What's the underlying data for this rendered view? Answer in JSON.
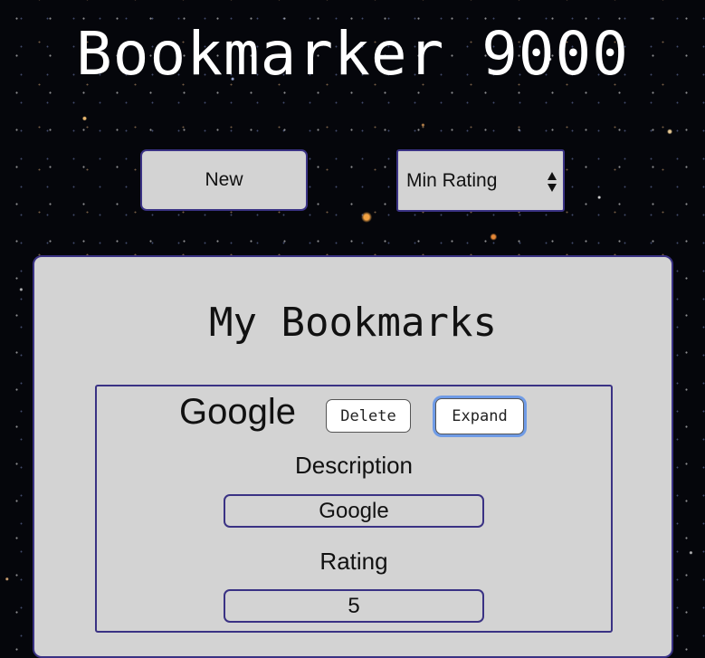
{
  "app": {
    "title": "Bookmarker 9000"
  },
  "toolbar": {
    "new_label": "New",
    "filter": {
      "selected": "Min Rating"
    }
  },
  "panel": {
    "title": "My Bookmarks"
  },
  "bookmarks": [
    {
      "title": "Google",
      "delete_label": "Delete",
      "expand_label": "Expand",
      "description_label": "Description",
      "description": "Google",
      "rating_label": "Rating",
      "rating": "5"
    }
  ],
  "colors": {
    "border": "#3a3284",
    "panel_bg": "#d3d3d3",
    "focus_ring": "#6f9be6"
  },
  "icons": {
    "select_arrows": "updown-arrows-icon"
  }
}
